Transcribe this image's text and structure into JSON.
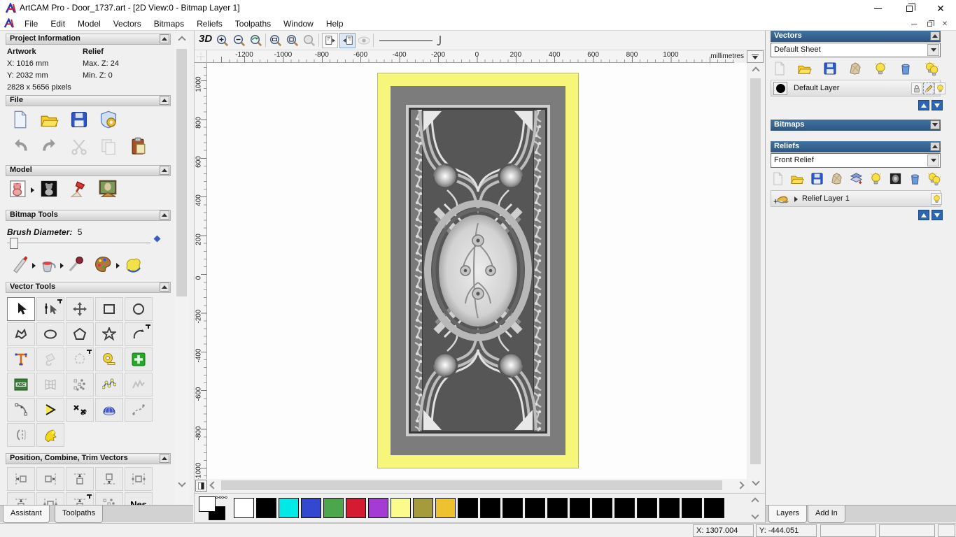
{
  "window": {
    "title": "ArtCAM Pro - Door_1737.art - [2D View:0 - Bitmap Layer 1]"
  },
  "menu": {
    "items": [
      "File",
      "Edit",
      "Model",
      "Vectors",
      "Bitmaps",
      "Reliefs",
      "Toolpaths",
      "Window",
      "Help"
    ]
  },
  "assistant": {
    "tabs": {
      "assistant": "Assistant",
      "toolpaths": "Toolpaths"
    },
    "project_information": {
      "title": "Project Information",
      "artwork_label": "Artwork",
      "artwork_x": "X: 1016 mm",
      "artwork_y": "Y: 2032 mm",
      "artwork_pixels": "2828 x 5656 pixels",
      "relief_label": "Relief",
      "relief_max_z": "Max. Z: 24",
      "relief_min_z": "Min. Z: 0"
    },
    "file_section": {
      "title": "File"
    },
    "model_section": {
      "title": "Model"
    },
    "bitmap_tools": {
      "title": "Bitmap Tools",
      "brush_diameter_label": "Brush Diameter:",
      "brush_diameter_value": "5"
    },
    "vector_tools": {
      "title": "Vector Tools"
    },
    "position_section": {
      "title": "Position, Combine, Trim Vectors",
      "nesting_label": "Nes"
    }
  },
  "canvas": {
    "toolbar": {
      "view_3d_label": "3D"
    },
    "h_ruler": {
      "ticks": [
        "-1200",
        "-1000",
        "-800",
        "-600",
        "-400",
        "-200",
        "0",
        "200",
        "400",
        "600",
        "800",
        "1000"
      ],
      "unit": "millimetres"
    },
    "v_ruler": {
      "ticks": [
        "1000",
        "800",
        "600",
        "400",
        "200",
        "0",
        "-200",
        "-400",
        "-600",
        "-800",
        "-1000"
      ]
    }
  },
  "palette": {
    "primary": "#ffffff",
    "secondary": "#000000",
    "colors": [
      "#ffffff",
      "#000000",
      "#00e8e8",
      "#3347d1",
      "#4ca64c",
      "#d41b32",
      "#a43bd4",
      "#fbfb8b",
      "#a59b3c",
      "#eec22e",
      "#000000",
      "#000000",
      "#000000",
      "#000000",
      "#000000",
      "#000000",
      "#000000",
      "#000000",
      "#000000",
      "#000000",
      "#000000",
      "#000000"
    ]
  },
  "panels": {
    "vectors": {
      "title": "Vectors",
      "sheet_selected": "Default Sheet",
      "layer_name": "Default Layer"
    },
    "bitmaps": {
      "title": "Bitmaps"
    },
    "reliefs": {
      "title": "Reliefs",
      "relief_selected": "Front Relief",
      "layer_name": "Relief Layer 1"
    },
    "tabs": {
      "layers": "Layers",
      "addin": "Add In"
    }
  },
  "status_bar": {
    "x": "X: 1307.004",
    "y": "Y: -444.051"
  },
  "colors": {
    "header_blue": "#2f6399",
    "door_border_yellow": "#f6f67b",
    "door_field_gray": "#7c7c7c"
  },
  "icons": {
    "new-file-icon": "page",
    "open-file-icon": "yellow-folder",
    "save-file-icon": "blue-floppy",
    "undo-icon": "curved-arrow-left",
    "redo-icon": "curved-arrow-right",
    "cut-icon": "scissors",
    "copy-icon": "pages",
    "paste-icon": "clipboard",
    "zoom-in-icon": "magnifier-plus",
    "zoom-out-icon": "magnifier-minus",
    "lightbulb-icon": "bulb",
    "delete-icon": "trash-can",
    "lock-icon": "padlock",
    "edit-icon": "pencil",
    "select-tool-icon": "cursor-arrow",
    "brush-icon": "paint-knife",
    "flood-fill-icon": "bucket",
    "eyedropper-icon": "dropper",
    "palette-icon": "paint-palette",
    "measure-icon": "tape-measure"
  }
}
